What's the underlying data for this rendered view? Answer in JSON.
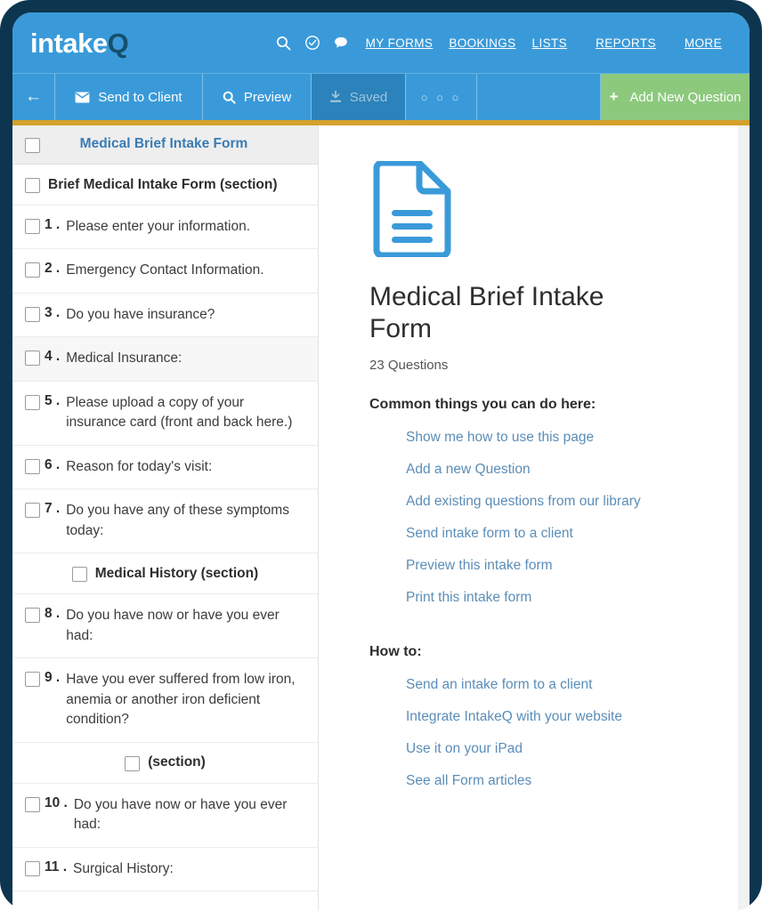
{
  "brand": {
    "logo_primary": "intake",
    "logo_accent": "Q",
    "bar_color": "#3a9ad9",
    "accent_gold": "#d4a12c",
    "add_button_green": "#8cc97d"
  },
  "nav": {
    "icons": [
      {
        "name": "search-icon",
        "glyph": "search"
      },
      {
        "name": "check-circle-icon",
        "glyph": "check-circle"
      },
      {
        "name": "chat-bubble-icon",
        "glyph": "chat"
      }
    ],
    "links": [
      {
        "label": "MY FORMS"
      },
      {
        "label": "BOOKINGS"
      },
      {
        "label": "LISTS"
      },
      {
        "label": "REPORTS"
      },
      {
        "label": "MORE"
      }
    ]
  },
  "toolbar": {
    "back_label": "←",
    "send_label": "Send to Client",
    "preview_label": "Preview",
    "saved_label": "Saved",
    "more_label": "○ ○ ○",
    "add_plus": "+",
    "add_label": "Add New Question"
  },
  "sidebar": {
    "header_title": "Medical Brief Intake Form",
    "rows": [
      {
        "kind": "section",
        "align": "left",
        "label": "Brief Medical Intake Form (section)"
      },
      {
        "kind": "question",
        "num": "1 .",
        "text": "Please enter your information."
      },
      {
        "kind": "question",
        "num": "2 .",
        "text": "Emergency Contact Information."
      },
      {
        "kind": "question",
        "num": "3 .",
        "text": "Do you have insurance?"
      },
      {
        "kind": "question",
        "num": "4 .",
        "text": "Medical Insurance:",
        "tinted": true
      },
      {
        "kind": "question",
        "num": "5 .",
        "text": "Please upload a copy of your insurance card (front and back here.)"
      },
      {
        "kind": "question",
        "num": "6 .",
        "text": "Reason for today's visit:"
      },
      {
        "kind": "question",
        "num": "7 .",
        "text": "Do you have any of these symptoms today:"
      },
      {
        "kind": "section",
        "align": "center",
        "label": "Medical History (section)"
      },
      {
        "kind": "question",
        "num": "8 .",
        "text": "Do you have now or have you ever had:"
      },
      {
        "kind": "question",
        "num": "9 .",
        "text": "Have you ever suffered from low iron, anemia or another iron deficient condition?"
      },
      {
        "kind": "section",
        "align": "center",
        "label": "(section)"
      },
      {
        "kind": "question",
        "num": "10 .",
        "text": "Do you have now or have you ever had:"
      },
      {
        "kind": "question",
        "num": "11 .",
        "text": "Surgical History:"
      }
    ]
  },
  "main": {
    "doc_icon": "document-icon",
    "form_title": "Medical Brief Intake Form",
    "question_count": "23 Questions",
    "common_heading": "Common things you can do here:",
    "common_links": [
      {
        "label": "Show me how to use this page"
      },
      {
        "label": "Add a new Question"
      },
      {
        "label": "Add existing questions from our library"
      },
      {
        "label": "Send intake form to a client"
      },
      {
        "label": "Preview this intake form"
      },
      {
        "label": "Print this intake form"
      }
    ],
    "howto_heading": "How to:",
    "howto_links": [
      {
        "label": "Send an intake form to a client"
      },
      {
        "label": "Integrate IntakeQ with your website"
      },
      {
        "label": "Use it on your iPad"
      },
      {
        "label": "See all Form articles"
      }
    ]
  }
}
